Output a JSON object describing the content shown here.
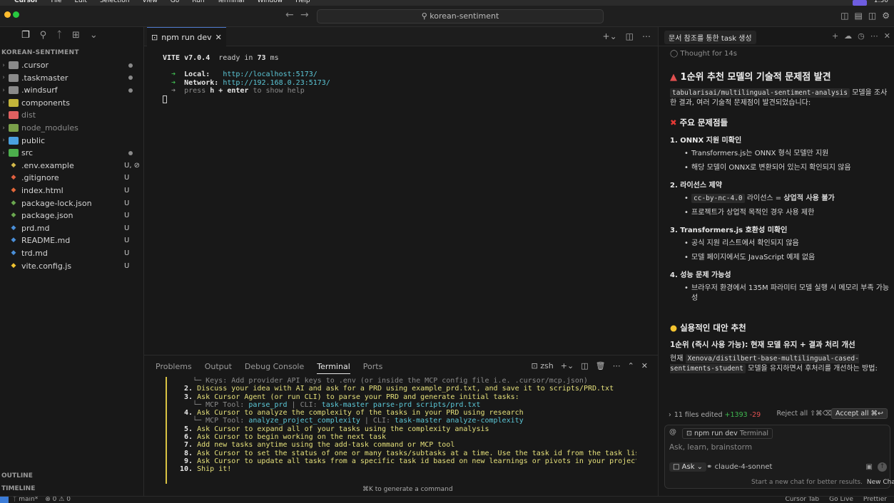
{
  "menubar": {
    "items": [
      "Cursor",
      "File",
      "Edit",
      "Selection",
      "View",
      "Go",
      "Run",
      "Terminal",
      "Window",
      "Help"
    ],
    "clock": "1:30"
  },
  "titlebar": {
    "search_text": "korean-sentiment"
  },
  "sidebar": {
    "explorer_title": "KOREAN-SENTIMENT",
    "items": [
      {
        "name": ".cursor",
        "type": "folder",
        "badge": "",
        "dot": true,
        "color": "#8a8a8a"
      },
      {
        "name": ".taskmaster",
        "type": "folder",
        "badge": "",
        "dot": true,
        "color": "#8a8a8a"
      },
      {
        "name": ".windsurf",
        "type": "folder",
        "badge": "",
        "dot": true,
        "color": "#8a8a8a"
      },
      {
        "name": "components",
        "type": "folder",
        "badge": "",
        "dot": false,
        "color": "#c3b43a"
      },
      {
        "name": "dist",
        "type": "folder",
        "badge": "",
        "dot": false,
        "color": "#e06060",
        "dim": true
      },
      {
        "name": "node_modules",
        "type": "folder",
        "badge": "",
        "dot": false,
        "color": "#7aa04a",
        "dim": true
      },
      {
        "name": "public",
        "type": "folder",
        "badge": "",
        "dot": false,
        "color": "#4aa0e0"
      },
      {
        "name": "src",
        "type": "folder",
        "badge": "",
        "dot": true,
        "color": "#4cae4c"
      },
      {
        "name": ".env.example",
        "type": "file",
        "badge": "U, ⊘",
        "dot": false,
        "color": "#d4b94a"
      },
      {
        "name": ".gitignore",
        "type": "file",
        "badge": "U",
        "dot": false,
        "color": "#e06040"
      },
      {
        "name": "index.html",
        "type": "file",
        "badge": "U",
        "dot": false,
        "color": "#e2673a"
      },
      {
        "name": "package-lock.json",
        "type": "file",
        "badge": "U",
        "dot": false,
        "color": "#6aa84f"
      },
      {
        "name": "package.json",
        "type": "file",
        "badge": "U",
        "dot": false,
        "color": "#6aa84f"
      },
      {
        "name": "prd.md",
        "type": "file",
        "badge": "U",
        "dot": false,
        "color": "#4a8fd8"
      },
      {
        "name": "README.md",
        "type": "file",
        "badge": "U",
        "dot": false,
        "color": "#4a8fd8"
      },
      {
        "name": "trd.md",
        "type": "file",
        "badge": "U",
        "dot": false,
        "color": "#4a8fd8"
      },
      {
        "name": "vite.config.js",
        "type": "file",
        "badge": "U",
        "dot": false,
        "color": "#f0c330"
      }
    ],
    "outline_label": "OUTLINE",
    "timeline_label": "TIMELINE"
  },
  "editor": {
    "tab_label": "npm run dev",
    "vite_line_1": "VITE v7.0.4",
    "vite_line_2": "ready in",
    "vite_ms": "73",
    "vite_ms_unit": "ms",
    "local_label": "Local:",
    "local_url": "http://localhost:5173/",
    "network_label": "Network:",
    "network_url": "http://192.168.0.23:5173/",
    "help_pre": "press",
    "help_key": "h + enter",
    "help_post": "to show help"
  },
  "panel": {
    "tabs": [
      "Problems",
      "Output",
      "Debug Console",
      "Terminal",
      "Ports"
    ],
    "active_tab": "Terminal",
    "shell": "zsh",
    "cmd_hint": "⌘K to generate a command",
    "lines": [
      {
        "pre": "   └─ Keys: Add provider API keys to .env (or inside the MCP config file i.e. .cursor/mcp.json)",
        "dim": true
      },
      {
        "num": "2.",
        "text": "Discuss your idea with AI and ask for a PRD using example_prd.txt, and save it to scripts/PRD.txt"
      },
      {
        "num": "3.",
        "text": "Ask Cursor Agent (or run CLI) to parse your PRD and generate initial tasks:"
      },
      {
        "sub": "   └─ MCP Tool: ",
        "tool": "parse_prd",
        "cli": " | CLI: ",
        "cmd": "task-master parse-prd scripts/prd.txt"
      },
      {
        "num": "4.",
        "text": "Ask Cursor to analyze the complexity of the tasks in your PRD using research"
      },
      {
        "sub": "   └─ MCP Tool: ",
        "tool": "analyze_project_complexity",
        "cli": " | CLI: ",
        "cmd": "task-master analyze-complexity"
      },
      {
        "num": "5.",
        "text": "Ask Cursor to expand all of your tasks using the complexity analysis"
      },
      {
        "num": "6.",
        "text": "Ask Cursor to begin working on the next task"
      },
      {
        "num": "7.",
        "text": "Add new tasks anytime using the add-task command or MCP tool"
      },
      {
        "num": "8.",
        "text": "Ask Cursor to set the status of one or many tasks/subtasks at a time. Use the task id from the task lists."
      },
      {
        "num": "9.",
        "text": "Ask Cursor to update all tasks from a specific task id based on new learnings or pivots in your project."
      },
      {
        "num": "10.",
        "text": "Ship it!"
      }
    ]
  },
  "chat": {
    "title": "문서 참조를 통한 task 생성",
    "thought": "Thought",
    "thought_dur": "for 14s",
    "heading": "1순위 추천 모델의 기술적 문제점 발견",
    "intro_code": "tabularisai/multilingual-sentiment-analysis",
    "intro_text": " 모델을 조사한 결과, 여러 기술적 문제점이 발견되었습니다:",
    "problems_heading": "주요 문제점들",
    "item1": "1. ONNX 지원 미확인",
    "item1_b1": "Transformers.js는 ONNX 형식 모델만 지원",
    "item1_b2": "해당 모델이 ONNX로 변환되어 있는지 확인되지 않음",
    "item2": "2. 라이선스 제약",
    "item2_code": "cc-by-nc-4.0",
    "item2_b1": " 라이선스 = ",
    "item2_b1_bold": "상업적 사용 불가",
    "item2_b2": "프로젝트가 상업적 목적인 경우 사용 제한",
    "item3": "3. Transformers.js 호환성 미확인",
    "item3_b1": "공식 지원 리스트에서 확인되지 않음",
    "item3_b2": "모델 페이지에서도 JavaScript 예제 없음",
    "item4": "4. 성능 문제 가능성",
    "item4_b1": "브라우저 환경에서 135M 파라미터 모델 실행 시 메모리 부족 가능성",
    "alt_heading": "실용적인 대안 추천",
    "rank1": "1순위 (즉시 사용 가능): 현재 모델 유지 + 결과 처리 개선",
    "rank1_pre": "현재 ",
    "rank1_code": "Xenova/distilbert-base-multilingual-cased-sentiments-student",
    "rank1_post": " 모델을 유지하면서 후처리를 개선하는 방법:",
    "edits_text": "11 files edited",
    "edits_add": "+1393",
    "edits_del": "-29",
    "reject_all": "Reject all ⇧⌘⌫",
    "accept_all": "Accept all ⌘↩",
    "ctx_chip": "npm run dev",
    "ctx_chip_kind": "Terminal",
    "input_placeholder": "Ask, learn, brainstorm",
    "mode": "Ask",
    "model": "claude-4-sonnet",
    "new_chat_hint": "Start a new chat for better results.",
    "new_chat": "New Chat"
  },
  "statusbar": {
    "branch": "main*",
    "errors": "0",
    "warnings": "0",
    "right": [
      "Cursor Tab",
      "Go Live",
      "Prettier"
    ]
  },
  "colors": {
    "accent": "#4d78cc",
    "terminal_green": "#3fb950",
    "terminal_cyan": "#5cc8d8",
    "terminal_yellow": "#e5e07a"
  }
}
